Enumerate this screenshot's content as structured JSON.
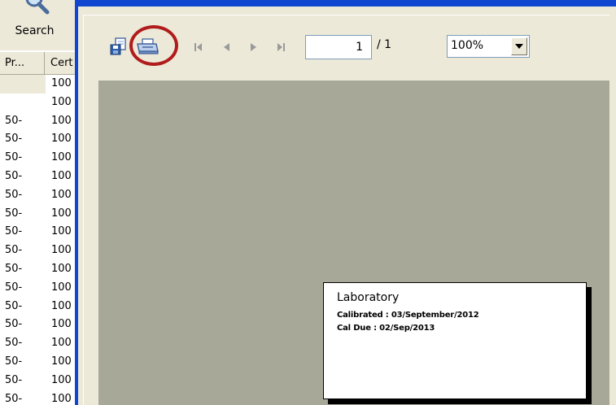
{
  "background_app": {
    "search_label": "Search",
    "grid": {
      "columns": [
        "Pr...",
        "Cert"
      ],
      "rows": [
        {
          "c0": "",
          "c1": "100",
          "selected": true
        },
        {
          "c0": "",
          "c1": "100",
          "selected": false
        },
        {
          "c0": "50-",
          "c1": "100",
          "selected": false
        },
        {
          "c0": "50-",
          "c1": "100",
          "selected": false
        },
        {
          "c0": "50-",
          "c1": "100",
          "selected": false
        },
        {
          "c0": "50-",
          "c1": "100",
          "selected": false
        },
        {
          "c0": "50-",
          "c1": "100",
          "selected": false
        },
        {
          "c0": "50-",
          "c1": "100",
          "selected": false
        },
        {
          "c0": "50-",
          "c1": "100",
          "selected": false
        },
        {
          "c0": "50-",
          "c1": "100",
          "selected": false
        },
        {
          "c0": "50-",
          "c1": "100",
          "selected": false
        },
        {
          "c0": "50-",
          "c1": "100",
          "selected": false
        },
        {
          "c0": "50-",
          "c1": "100",
          "selected": false
        },
        {
          "c0": "50-",
          "c1": "100",
          "selected": false
        },
        {
          "c0": "50-",
          "c1": "100",
          "selected": false
        },
        {
          "c0": "50-",
          "c1": "100",
          "selected": false
        },
        {
          "c0": "50-",
          "c1": "100",
          "selected": false
        },
        {
          "c0": "50-",
          "c1": "100",
          "selected": false
        }
      ]
    }
  },
  "viewer": {
    "toolbar": {
      "page_current": "1",
      "page_total": "/ 1",
      "zoom": "100%"
    },
    "report": {
      "title": "Laboratory",
      "line1": "Calibrated : 03/September/2012",
      "line2": "Cal Due : 02/Sep/2013"
    }
  },
  "colors": {
    "window_border": "#1046d0",
    "preview_background": "#a8a898",
    "highlight_circle": "#b01c1c",
    "chrome": "#ece9d8"
  },
  "icons": {
    "search": "magnifier-icon",
    "export": "export-icon",
    "print": "printer-icon",
    "first": "first-page-icon",
    "prev": "prev-page-icon",
    "next": "next-page-icon",
    "last": "last-page-icon",
    "dropdown": "chevron-down-icon"
  }
}
